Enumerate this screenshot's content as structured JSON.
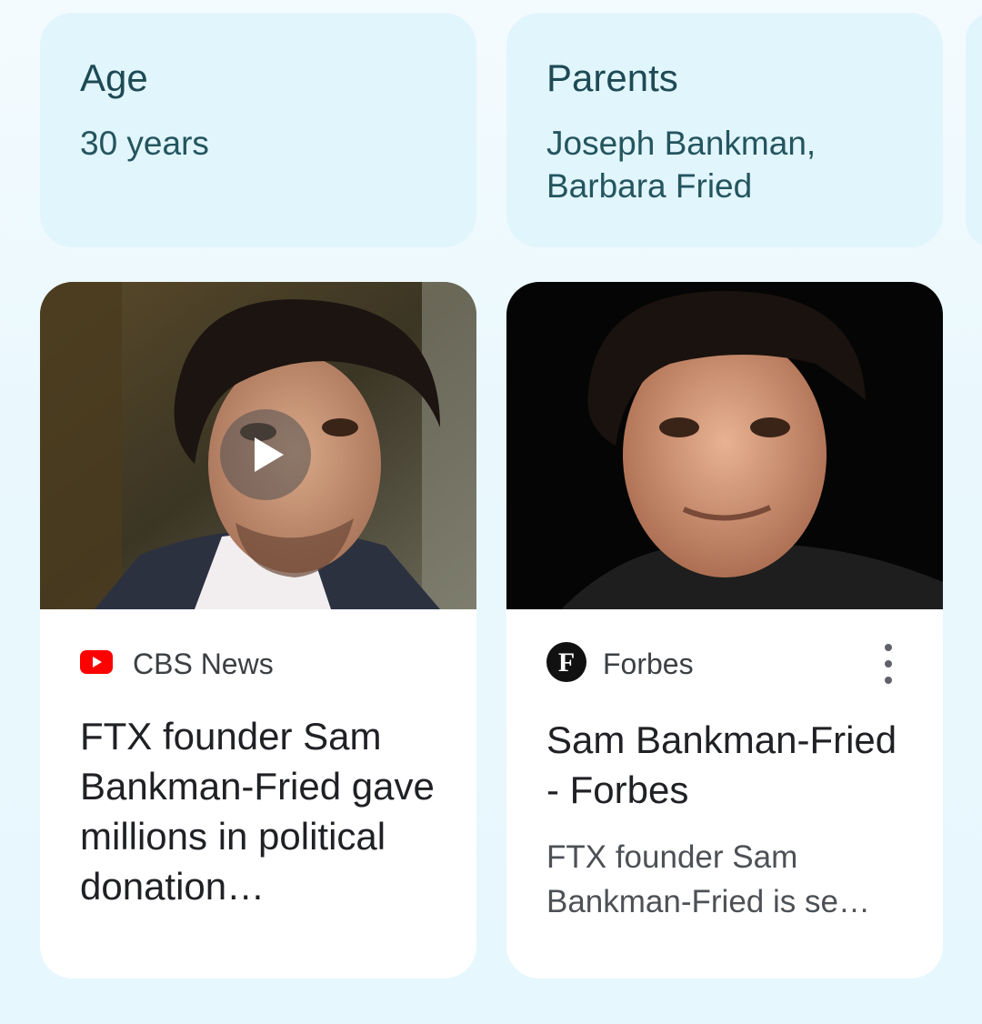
{
  "facts": [
    {
      "label": "Age",
      "value_lines": [
        "30 years"
      ]
    },
    {
      "label": "Parents",
      "value_lines": [
        "Joseph Bankman,",
        "Barbara Fried"
      ]
    }
  ],
  "news": [
    {
      "source": "CBS News",
      "source_icon": "youtube-icon",
      "title": "FTX founder Sam Bankman-Fried gave millions in political donation…",
      "is_video": true
    },
    {
      "source": "Forbes",
      "source_icon": "forbes-icon",
      "source_icon_letter": "F",
      "title": "Sam Bankman-Fried - Forbes",
      "snippet": "FTX founder Sam Bankman-Fried is se…",
      "menu_icon": "more-vert-icon"
    }
  ],
  "colors": {
    "youtube_red": "#ff0000",
    "fact_card_bg": "#e1f5fc"
  }
}
